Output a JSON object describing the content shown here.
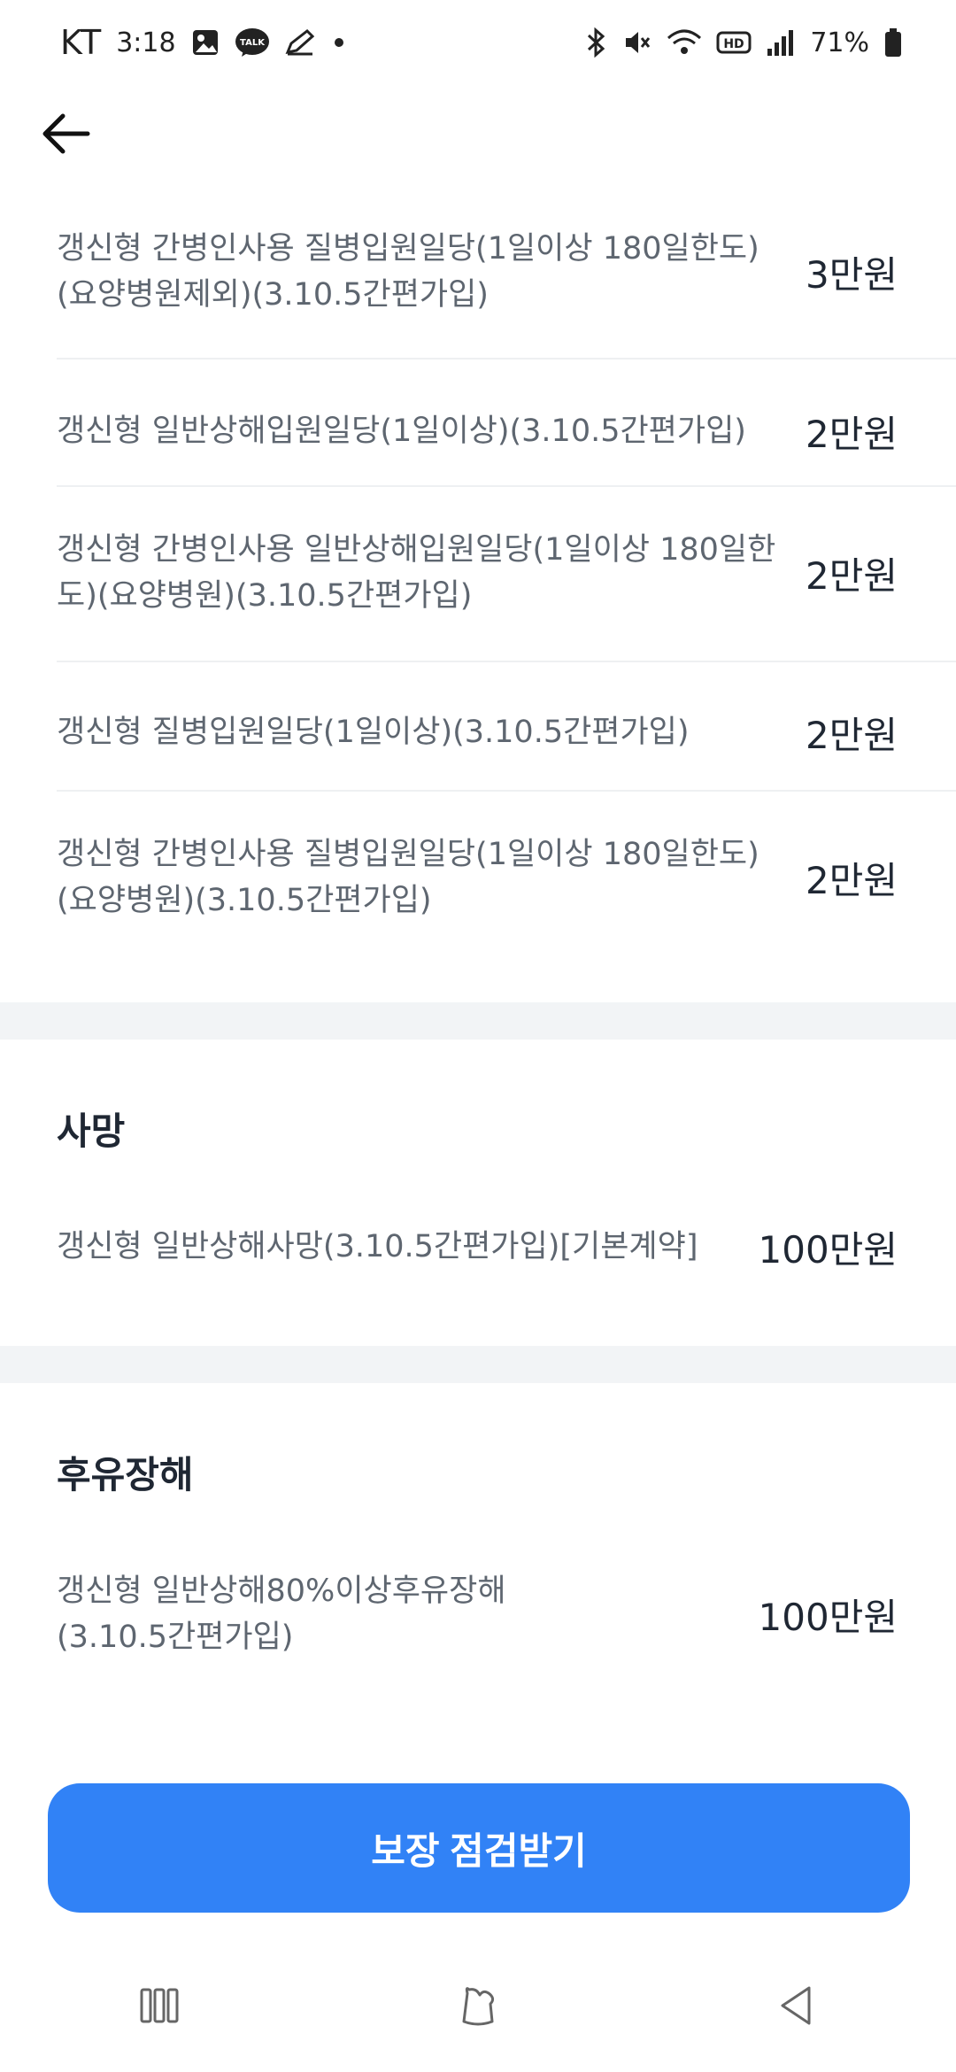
{
  "status_bar": {
    "carrier": "KT",
    "time": "3:18",
    "battery": "71%"
  },
  "rows_hospital": [
    {
      "label": "갱신형 간병인사용 질병입원일당(1일이상 180일한도)(요양병원제외)(3.10.5간편가입)",
      "value": "3만원"
    },
    {
      "label": "갱신형 일반상해입원일당(1일이상)(3.10.5간편가입)",
      "value": "2만원"
    },
    {
      "label": "갱신형 간병인사용 일반상해입원일당(1일이상 180일한도)(요양병원)(3.10.5간편가입)",
      "value": "2만원"
    },
    {
      "label": "갱신형 질병입원일당(1일이상)(3.10.5간편가입)",
      "value": "2만원"
    },
    {
      "label": "갱신형 간병인사용 질병입원일당(1일이상 180일한도)(요양병원)(3.10.5간편가입)",
      "value": "2만원"
    }
  ],
  "section_death": {
    "title": "사망",
    "rows": [
      {
        "label": "갱신형 일반상해사망(3.10.5간편가입)[기본계약]",
        "value": "100만원"
      }
    ]
  },
  "section_disability": {
    "title": "후유장해",
    "rows": [
      {
        "label": "갱신형 일반상해80%이상후유장해(3.10.5간편가입)",
        "value": "100만원"
      }
    ]
  },
  "cta": {
    "label": "보장 점검받기"
  },
  "icons": {
    "back": "back-arrow-icon",
    "nav_recents": "recents-icon",
    "nav_home": "home-icon",
    "nav_back": "nav-back-icon"
  },
  "colors": {
    "accent": "#3182f6",
    "label": "#5e6670",
    "value": "#1f2733",
    "band": "#f2f4f6"
  }
}
